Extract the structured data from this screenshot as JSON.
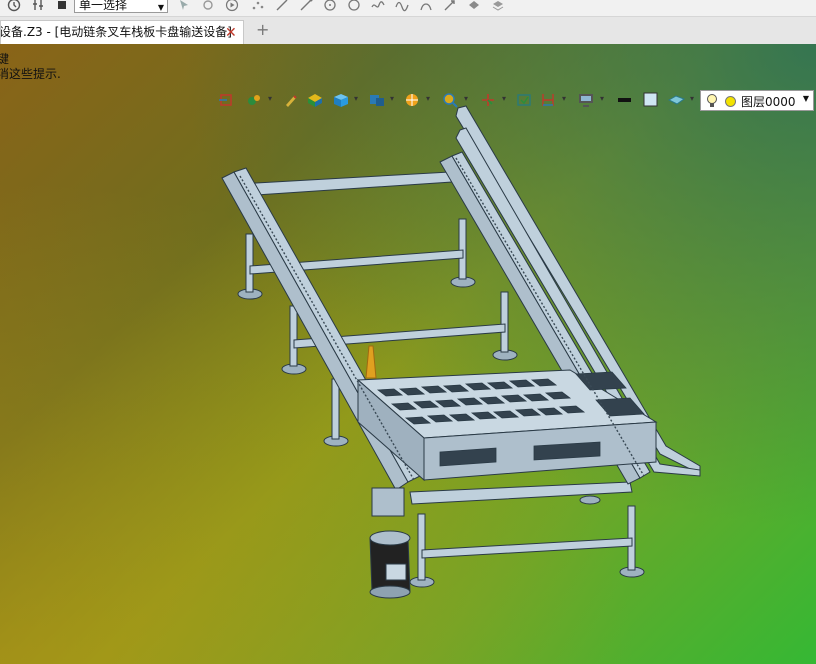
{
  "toolbar": {
    "select_mode": "单一选择",
    "icons": [
      "history-icon",
      "pin-icon",
      "stop-icon",
      "cursor-icon",
      "filter-icon",
      "play-icon",
      "points-icon",
      "line-icon",
      "curve-icon",
      "circle-icon",
      "spline-icon",
      "wave-icon",
      "arc-icon",
      "arrow-icon",
      "surface-icon",
      "shell-icon"
    ]
  },
  "tab": {
    "title": "设备.Z3 - [电动链条叉车栈板卡盘输送设备]",
    "close_label": "✕",
    "new_label": "+"
  },
  "viewport": {
    "hint_line1": "键",
    "hint_line2": "消这些提示.",
    "layer_name": "图层0000",
    "view_tools": [
      "view-select-icon",
      "palette-icon",
      "brush-icon",
      "solid-icon",
      "cube-icon",
      "display-mode-icon",
      "render-icon",
      "zoom-icon",
      "axis-icon",
      "camera-icon",
      "measure-icon",
      "monitor-icon",
      "line-color-icon",
      "fill-color-icon",
      "surface-color-icon"
    ],
    "colors": {
      "bg_top_left": "#8a6418",
      "bg_center": "#8a9a1c",
      "bg_bottom_right": "#35b834",
      "model": "#bfd0dc",
      "model_edge": "#2a3a46"
    }
  }
}
